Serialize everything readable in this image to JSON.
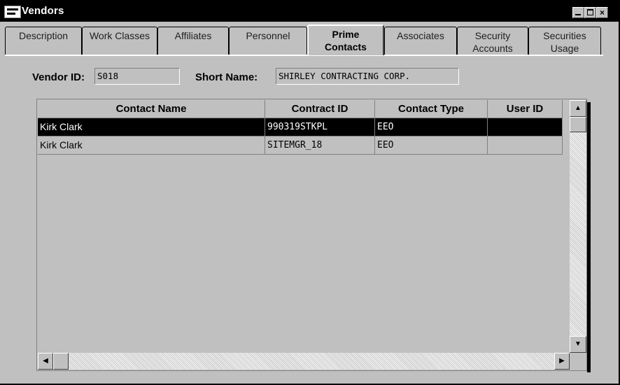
{
  "window": {
    "title": "Vendors",
    "app_icon": "vendors-app-icon",
    "controls": {
      "minimize": "minimize-icon",
      "maximize": "maximize-icon",
      "close_label": "×"
    }
  },
  "tabs": [
    {
      "line1": "Description",
      "line2": "",
      "active": false
    },
    {
      "line1": "Work Classes",
      "line2": "",
      "active": false
    },
    {
      "line1": "Affiliates",
      "line2": "",
      "active": false
    },
    {
      "line1": "Personnel",
      "line2": "",
      "active": false
    },
    {
      "line1": "Prime",
      "line2": "Contacts",
      "active": true
    },
    {
      "line1": "Associates",
      "line2": "",
      "active": false
    },
    {
      "line1": "Security",
      "line2": "Accounts",
      "active": false
    },
    {
      "line1": "Securities",
      "line2": "Usage",
      "active": false
    }
  ],
  "header": {
    "vendor_id_label": "Vendor ID:",
    "vendor_id_value": "S018",
    "short_name_label": "Short Name:",
    "short_name_value": "SHIRLEY CONTRACTING CORP."
  },
  "grid": {
    "columns": [
      "Contact Name",
      "Contract ID",
      "Contact Type",
      "User ID"
    ],
    "rows": [
      {
        "contact_name": "Kirk Clark",
        "contract_id": "990319STKPL",
        "contact_type": "EEO",
        "user_id": "",
        "selected": true
      },
      {
        "contact_name": "Kirk Clark",
        "contract_id": "SITEMGR_18",
        "contact_type": "EEO",
        "user_id": "",
        "selected": false
      }
    ]
  },
  "scrollbars": {
    "up_arrow": "▲",
    "down_arrow": "▼",
    "left_arrow": "◀",
    "right_arrow": "▶"
  }
}
